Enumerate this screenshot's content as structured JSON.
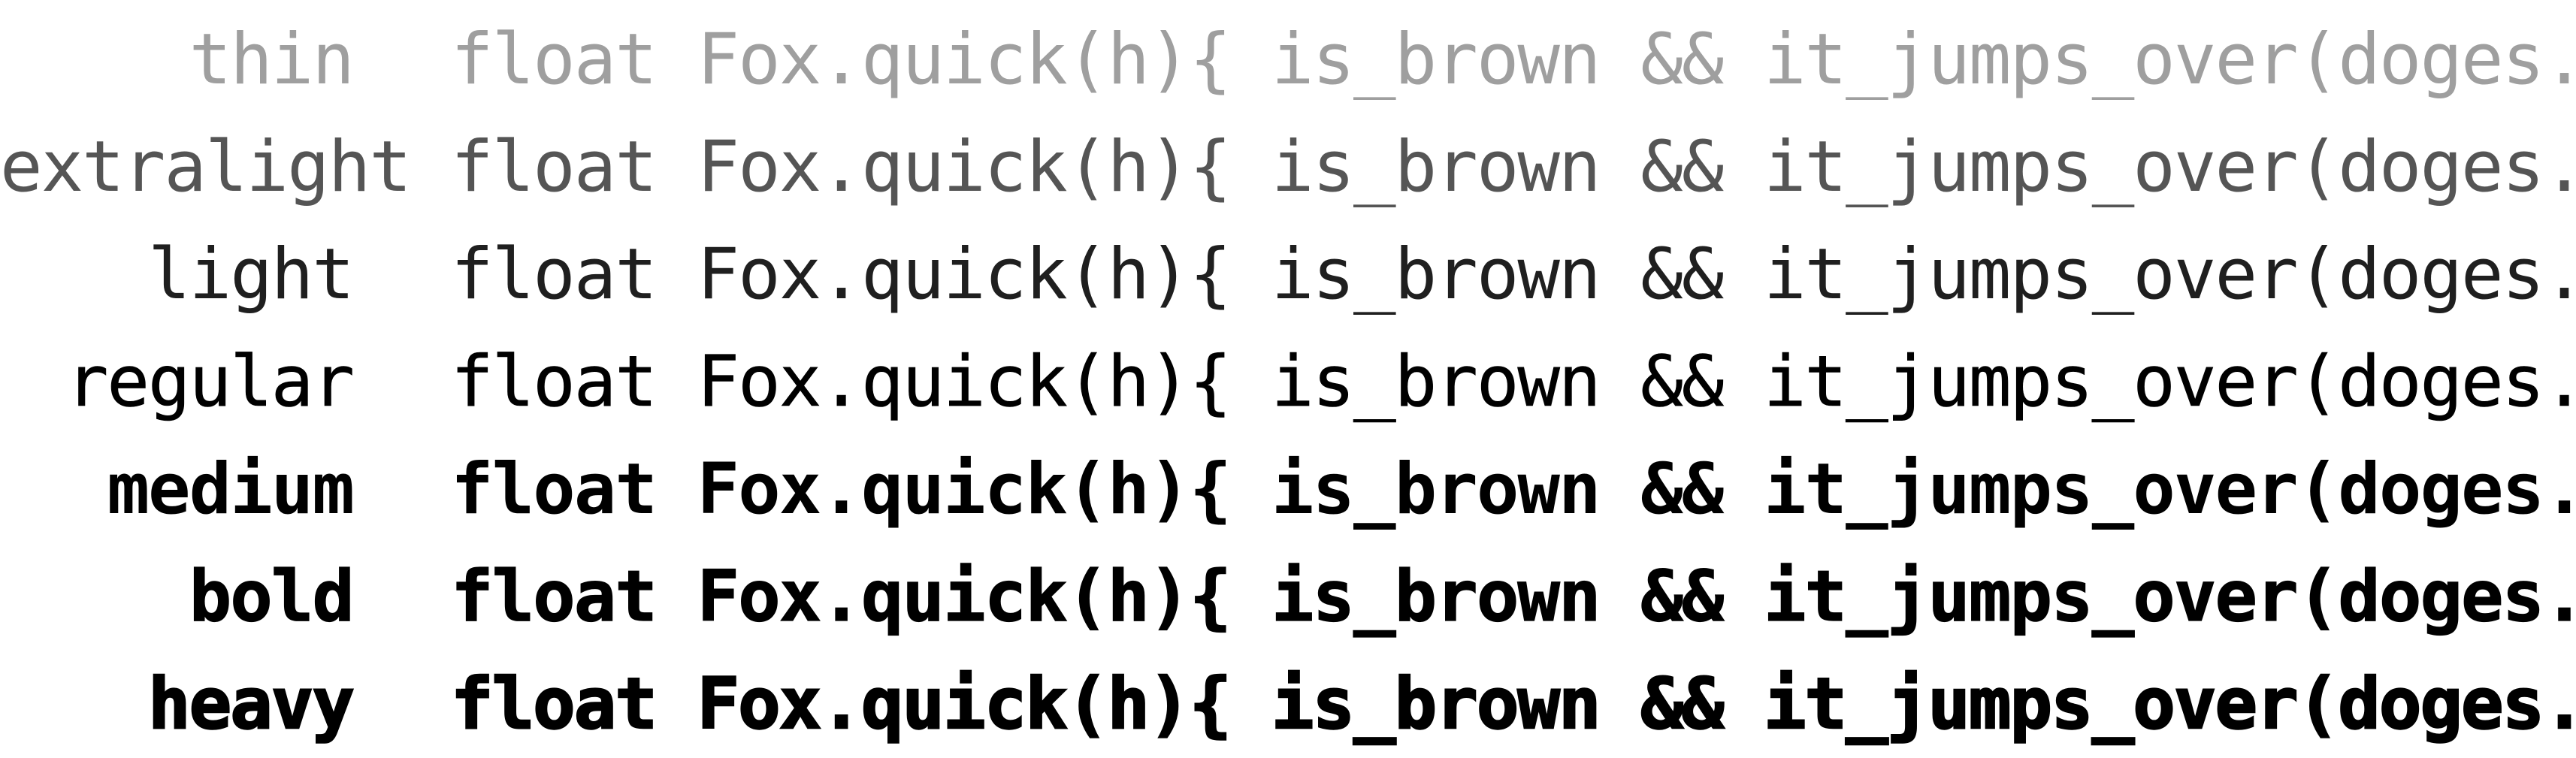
{
  "sample_code": "float Fox.quick(h){ is_brown && it_jumps_over(doges.lazy) }",
  "rows": [
    {
      "weight": "thin",
      "code": "float Fox.quick(h){ is_brown && it_jumps_over(doges.lazy) }"
    },
    {
      "weight": "extralight",
      "code": "float Fox.quick(h){ is_brown && it_jumps_over(doges.lazy) }"
    },
    {
      "weight": "light",
      "code": "float Fox.quick(h){ is_brown && it_jumps_over(doges.lazy) }"
    },
    {
      "weight": "regular",
      "code": "float Fox.quick(h){ is_brown && it_jumps_over(doges.lazy) }"
    },
    {
      "weight": "medium",
      "code": "float Fox.quick(h){ is_brown && it_jumps_over(doges.lazy) }"
    },
    {
      "weight": "bold",
      "code": "float Fox.quick(h){ is_brown && it_jumps_over(doges.lazy) }"
    },
    {
      "weight": "heavy",
      "code": "float Fox.quick(h){ is_brown && it_jumps_over(doges.lazy) }"
    }
  ],
  "colors": {
    "background": "#ffffff",
    "thin": "#9a9a9a",
    "extralight": "#555555",
    "light": "#1f1f1f",
    "regular": "#000000",
    "medium": "#000000",
    "bold": "#000000",
    "heavy": "#000000"
  }
}
